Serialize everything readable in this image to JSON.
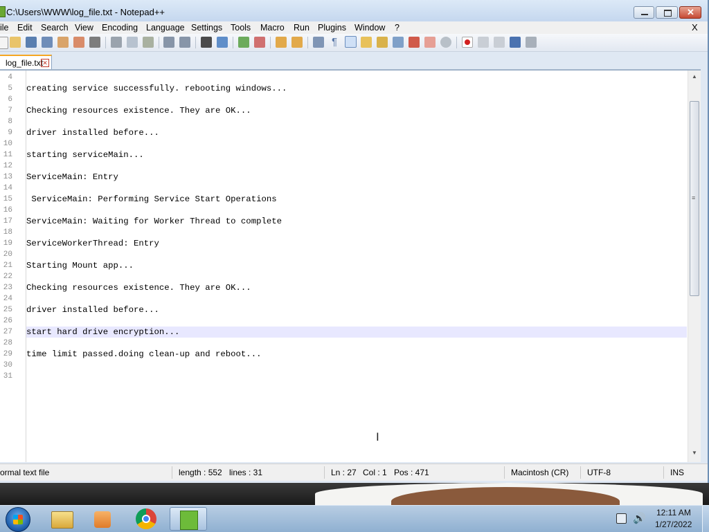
{
  "window": {
    "title": "C:\\Users\\WWW\\log_file.txt - Notepad++"
  },
  "menu": {
    "items": [
      "ile",
      "Edit",
      "Search",
      "View",
      "Encoding",
      "Language",
      "Settings",
      "Tools",
      "Macro",
      "Run",
      "Plugins",
      "Window",
      "?"
    ],
    "close_label": "X"
  },
  "toolbar": {
    "icons": [
      "new-file-icon",
      "open-file-icon",
      "save-icon",
      "save-all-icon",
      "close-file-icon",
      "close-all-icon",
      "print-icon",
      "cut-icon",
      "copy-icon",
      "paste-icon",
      "undo-icon",
      "redo-icon",
      "find-icon",
      "replace-icon",
      "zoom-in-icon",
      "zoom-out-icon",
      "sync-vertical-icon",
      "sync-horizontal-icon",
      "word-wrap-icon",
      "show-all-characters-icon",
      "indent-guide-icon",
      "language-folder-icon",
      "document-map-icon",
      "function-list-icon",
      "folder-as-workspace-icon",
      "monitoring-icon",
      "record-macro-icon",
      "stop-macro-icon",
      "play-macro-icon",
      "run-macro-multiple-icon",
      "save-macro-icon"
    ],
    "active_icon": "indent-guide-icon"
  },
  "tabs": [
    {
      "label": "log_file.txt",
      "close": "✕"
    }
  ],
  "editor": {
    "caret_line": 27,
    "lines": [
      {
        "num": "4",
        "text": ""
      },
      {
        "num": "5",
        "text": "creating service successfully. rebooting windows..."
      },
      {
        "num": "6",
        "text": ""
      },
      {
        "num": "7",
        "text": "Checking resources existence. They are OK..."
      },
      {
        "num": "8",
        "text": ""
      },
      {
        "num": "9",
        "text": "driver installed before..."
      },
      {
        "num": "10",
        "text": ""
      },
      {
        "num": "11",
        "text": "starting serviceMain..."
      },
      {
        "num": "12",
        "text": ""
      },
      {
        "num": "13",
        "text": "ServiceMain: Entry"
      },
      {
        "num": "14",
        "text": ""
      },
      {
        "num": "15",
        "text": " ServiceMain: Performing Service Start Operations"
      },
      {
        "num": "16",
        "text": ""
      },
      {
        "num": "17",
        "text": "ServiceMain: Waiting for Worker Thread to complete"
      },
      {
        "num": "18",
        "text": ""
      },
      {
        "num": "19",
        "text": "ServiceWorkerThread: Entry"
      },
      {
        "num": "20",
        "text": ""
      },
      {
        "num": "21",
        "text": "Starting Mount app..."
      },
      {
        "num": "22",
        "text": ""
      },
      {
        "num": "23",
        "text": "Checking resources existence. They are OK..."
      },
      {
        "num": "24",
        "text": ""
      },
      {
        "num": "25",
        "text": "driver installed before..."
      },
      {
        "num": "26",
        "text": ""
      },
      {
        "num": "27",
        "text": "start hard drive encryption..."
      },
      {
        "num": "28",
        "text": ""
      },
      {
        "num": "29",
        "text": "time limit passed.doing clean-up and reboot..."
      },
      {
        "num": "30",
        "text": ""
      },
      {
        "num": "31",
        "text": ""
      }
    ]
  },
  "status": {
    "file_type": "ormal text file",
    "length": "length : 552",
    "lines": "lines : 31",
    "ln": "Ln : 27",
    "col": "Col : 1",
    "pos": "Pos : 471",
    "eol": "Macintosh (CR)",
    "encoding": "UTF-8",
    "mode": "INS"
  },
  "taskbar": {
    "apps": [
      "windows-explorer-icon",
      "media-player-icon",
      "chrome-icon",
      "notepadpp-icon"
    ],
    "active_app": "notepadpp-icon",
    "clock_time": "12:11 AM",
    "clock_date": "1/27/2022"
  }
}
